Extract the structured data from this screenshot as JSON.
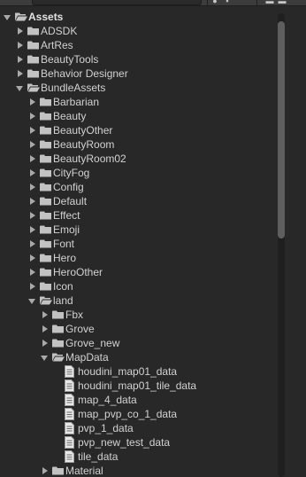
{
  "toolbar": {
    "icons": [
      "eye-icon",
      "lock-icon",
      "star-icon"
    ]
  },
  "tree": [
    {
      "label": "Assets",
      "depth": 0,
      "expanded": true,
      "kind": "folder",
      "bold": true
    },
    {
      "label": "ADSDK",
      "depth": 1,
      "expanded": false,
      "kind": "folder"
    },
    {
      "label": "ArtRes",
      "depth": 1,
      "expanded": false,
      "kind": "folder"
    },
    {
      "label": "BeautyTools",
      "depth": 1,
      "expanded": false,
      "kind": "folder"
    },
    {
      "label": "Behavior Designer",
      "depth": 1,
      "expanded": false,
      "kind": "folder"
    },
    {
      "label": "BundleAssets",
      "depth": 1,
      "expanded": true,
      "kind": "folder"
    },
    {
      "label": "Barbarian",
      "depth": 2,
      "expanded": false,
      "kind": "folder"
    },
    {
      "label": "Beauty",
      "depth": 2,
      "expanded": false,
      "kind": "folder"
    },
    {
      "label": "BeautyOther",
      "depth": 2,
      "expanded": false,
      "kind": "folder"
    },
    {
      "label": "BeautyRoom",
      "depth": 2,
      "expanded": false,
      "kind": "folder"
    },
    {
      "label": "BeautyRoom02",
      "depth": 2,
      "expanded": false,
      "kind": "folder"
    },
    {
      "label": "CityFog",
      "depth": 2,
      "expanded": false,
      "kind": "folder"
    },
    {
      "label": "Config",
      "depth": 2,
      "expanded": false,
      "kind": "folder"
    },
    {
      "label": "Default",
      "depth": 2,
      "expanded": false,
      "kind": "folder"
    },
    {
      "label": "Effect",
      "depth": 2,
      "expanded": false,
      "kind": "folder"
    },
    {
      "label": "Emoji",
      "depth": 2,
      "expanded": false,
      "kind": "folder"
    },
    {
      "label": "Font",
      "depth": 2,
      "expanded": false,
      "kind": "folder"
    },
    {
      "label": "Hero",
      "depth": 2,
      "expanded": false,
      "kind": "folder"
    },
    {
      "label": "HeroOther",
      "depth": 2,
      "expanded": false,
      "kind": "folder"
    },
    {
      "label": "Icon",
      "depth": 2,
      "expanded": false,
      "kind": "folder"
    },
    {
      "label": "land",
      "depth": 2,
      "expanded": true,
      "kind": "folder"
    },
    {
      "label": "Fbx",
      "depth": 3,
      "expanded": false,
      "kind": "folder"
    },
    {
      "label": "Grove",
      "depth": 3,
      "expanded": false,
      "kind": "folder"
    },
    {
      "label": "Grove_new",
      "depth": 3,
      "expanded": false,
      "kind": "folder"
    },
    {
      "label": "MapData",
      "depth": 3,
      "expanded": true,
      "kind": "folder"
    },
    {
      "label": "houdini_map01_data",
      "depth": 4,
      "kind": "file"
    },
    {
      "label": "houdini_map01_tile_data",
      "depth": 4,
      "kind": "file"
    },
    {
      "label": "map_4_data",
      "depth": 4,
      "kind": "file"
    },
    {
      "label": "map_pvp_co_1_data",
      "depth": 4,
      "kind": "file"
    },
    {
      "label": "pvp_1_data",
      "depth": 4,
      "kind": "file"
    },
    {
      "label": "pvp_new_test_data",
      "depth": 4,
      "kind": "file"
    },
    {
      "label": "tile_data",
      "depth": 4,
      "kind": "file"
    },
    {
      "label": "Material",
      "depth": 3,
      "expanded": false,
      "kind": "folder"
    }
  ],
  "colors": {
    "background": "#282828",
    "text": "#d2d2d2",
    "folder": "#c2c2c2",
    "arrow": "#a9a9a9"
  }
}
